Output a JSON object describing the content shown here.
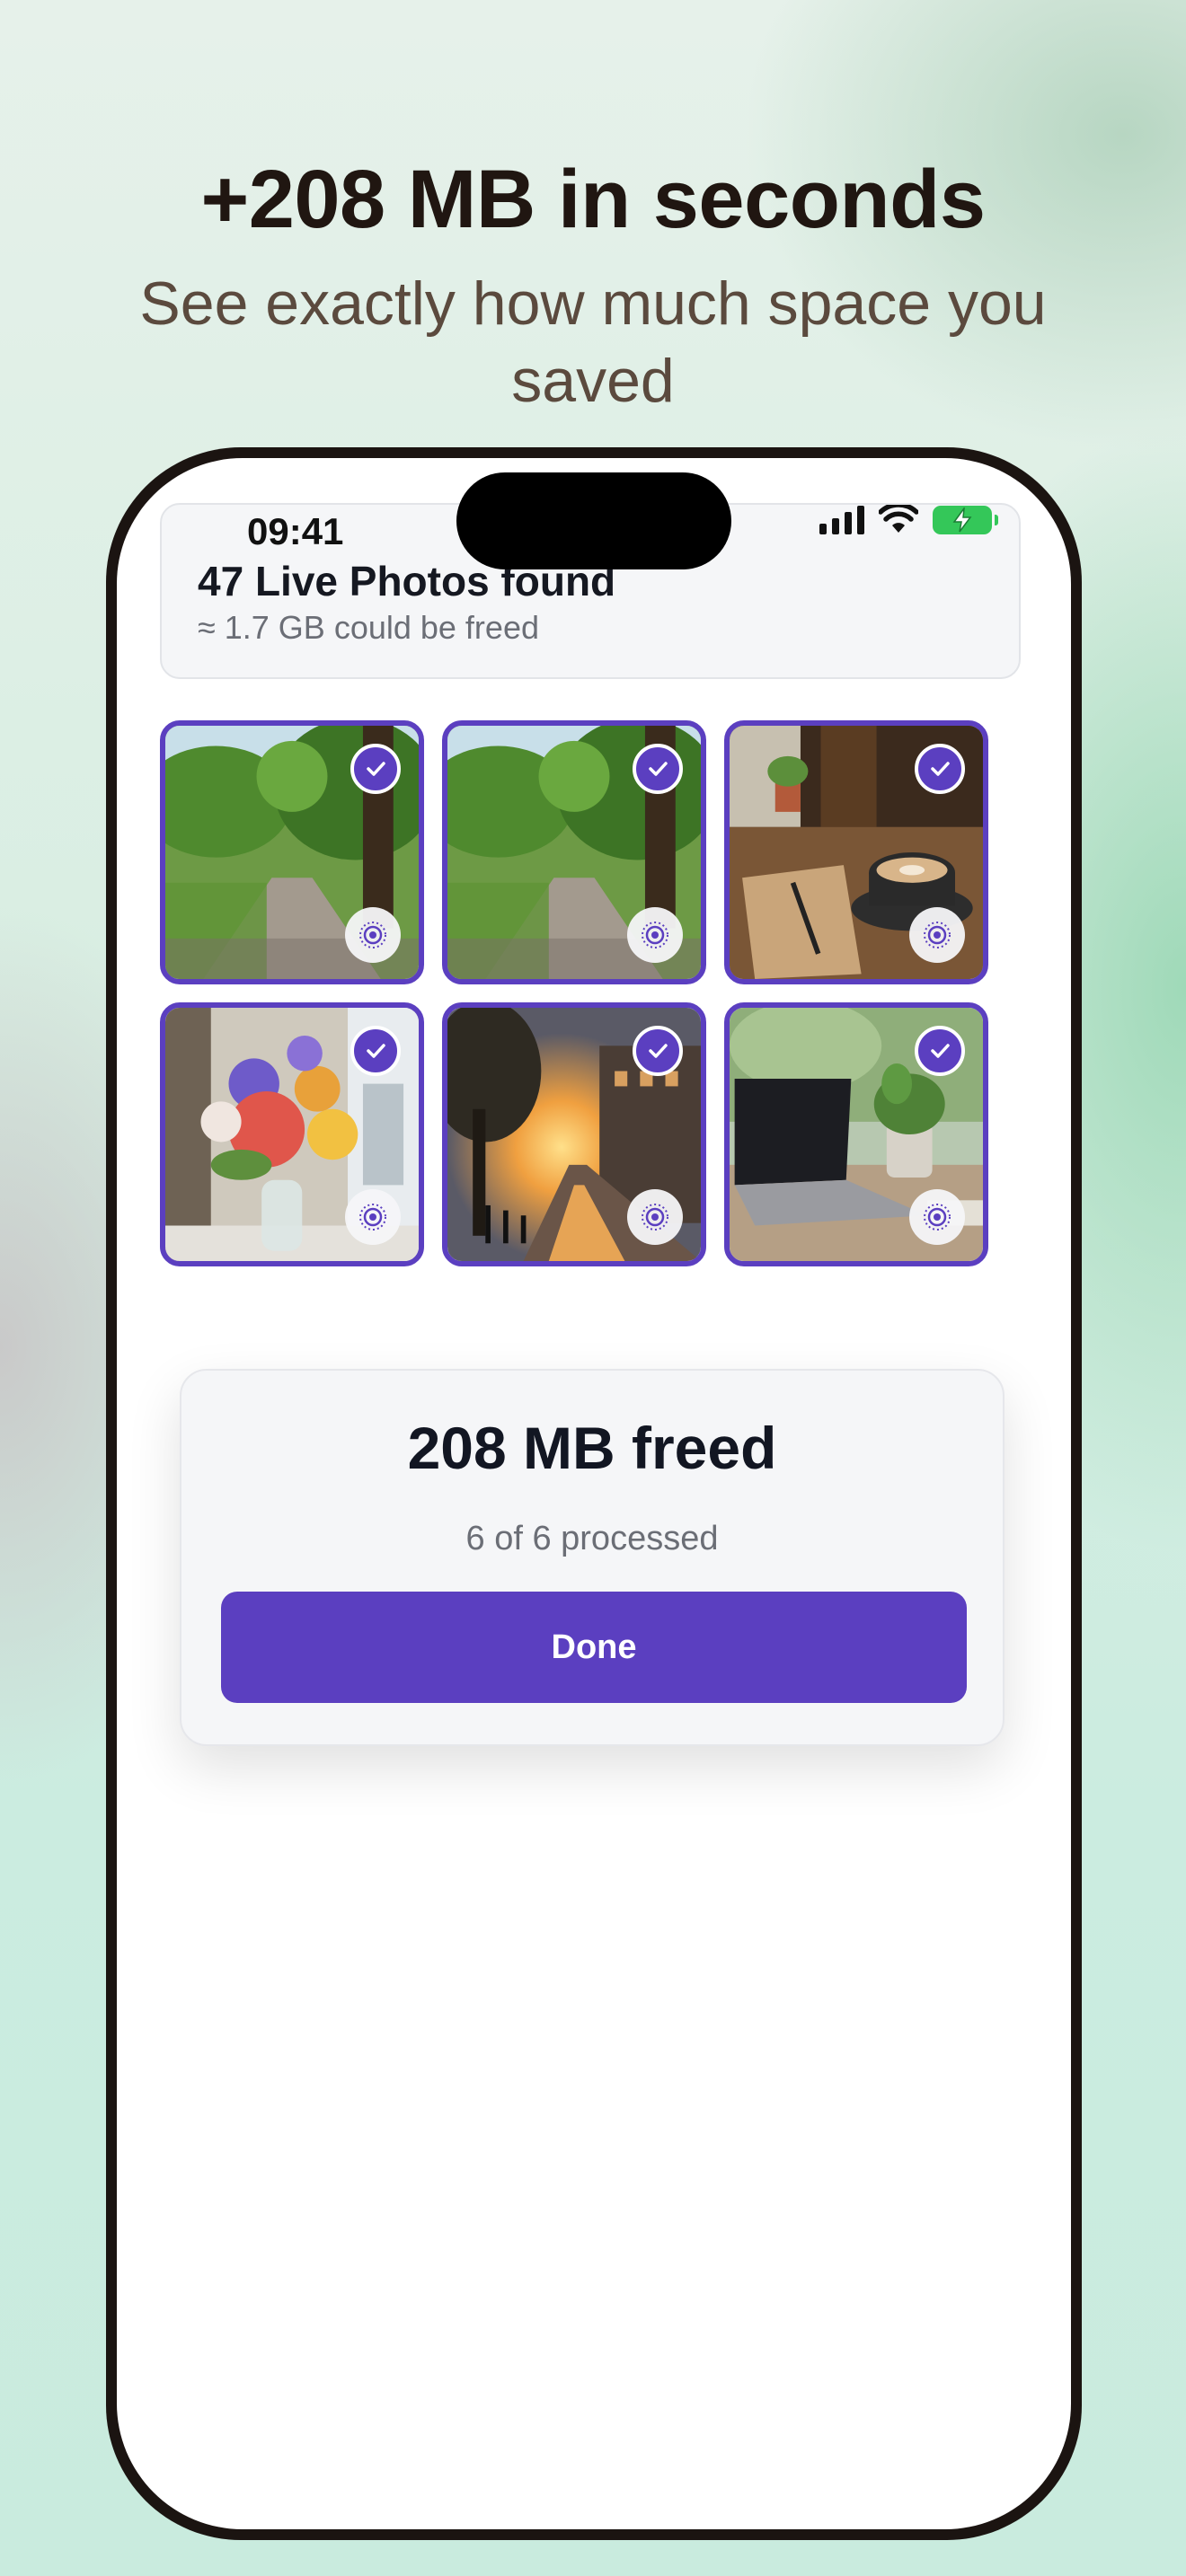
{
  "promo": {
    "headline": "+208 MB in seconds",
    "subline": "See exactly how much space you saved"
  },
  "status_bar": {
    "time": "09:41",
    "icons": [
      "signal-icon",
      "wifi-icon",
      "battery-charging-icon"
    ]
  },
  "summary": {
    "title": "47 Live Photos found",
    "subtitle": "≈ 1.7 GB could be freed"
  },
  "photos": [
    {
      "subject": "tree-lined park path",
      "selected": true,
      "badge": "live-photo-icon"
    },
    {
      "subject": "tree-lined park path",
      "selected": true,
      "badge": "live-photo-icon"
    },
    {
      "subject": "latte and notebook on table",
      "selected": true,
      "badge": "live-photo-icon"
    },
    {
      "subject": "flower bouquet by window",
      "selected": true,
      "badge": "live-photo-icon"
    },
    {
      "subject": "sunset city street",
      "selected": true,
      "badge": "live-photo-icon"
    },
    {
      "subject": "laptop and plant on desk",
      "selected": true,
      "badge": "live-photo-icon"
    }
  ],
  "result": {
    "title": "208 MB freed",
    "progress_text": "6 of 6 processed",
    "processed": 6,
    "total": 6,
    "done_label": "Done"
  },
  "colors": {
    "accent": "#5b3fc0",
    "battery": "#34c759"
  }
}
